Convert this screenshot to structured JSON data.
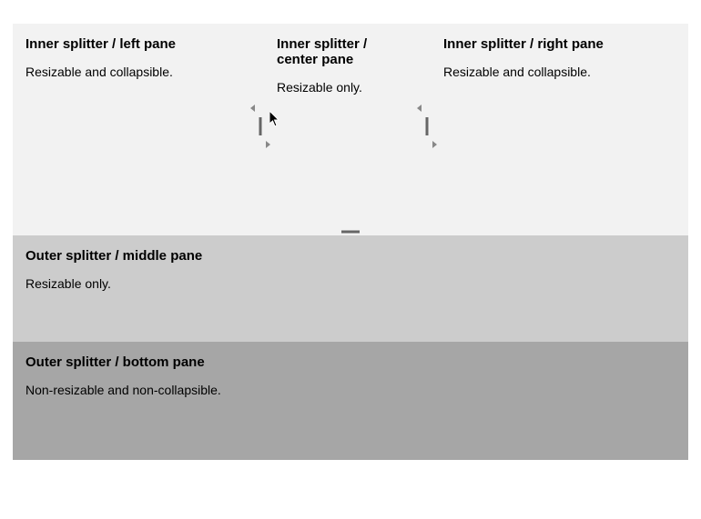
{
  "outer": {
    "top": {
      "inner": {
        "left": {
          "title": "Inner splitter / left pane",
          "desc": "Resizable and collapsible."
        },
        "center": {
          "title": "Inner splitter / center pane",
          "desc": "Resizable only."
        },
        "right": {
          "title": "Inner splitter / right pane",
          "desc": "Resizable and collapsible."
        }
      }
    },
    "middle": {
      "title": "Outer splitter / middle pane",
      "desc": "Resizable only."
    },
    "bottom": {
      "title": "Outer splitter / bottom pane",
      "desc": "Non-resizable and non-collapsible."
    }
  }
}
